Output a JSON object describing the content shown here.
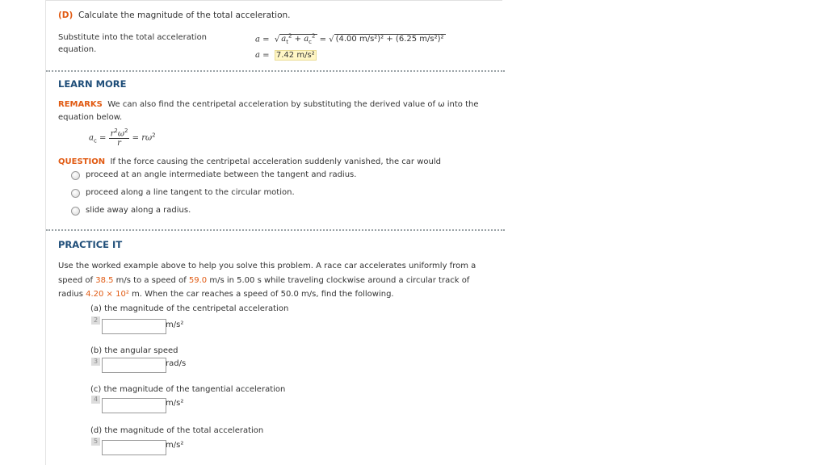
{
  "part_d": {
    "label": "(D)",
    "title": "Calculate the magnitude of the total acceleration.",
    "instruction_line1": "Substitute into the total acceleration",
    "instruction_line2": "equation.",
    "formula_rhs": "(4.00 m/s²)² + (6.25 m/s²)²",
    "result_value": "7.42 m/s²"
  },
  "learn_more": {
    "heading": "LEARN MORE",
    "remarks_label": "REMARKS",
    "remarks_text_1": "We can also find the centripetal acceleration by substituting the derived value of ω into the",
    "remarks_text_2": "equation below.",
    "question_label": "QUESTION",
    "question_text": "If the force causing the centripetal acceleration suddenly vanished, the car would",
    "options": [
      "proceed at an angle intermediate between the tangent and radius.",
      "proceed along a line tangent to the circular motion.",
      "slide away along a radius."
    ]
  },
  "practice": {
    "heading": "PRACTICE IT",
    "p1": "Use the worked example above to help you solve this problem. A race car accelerates uniformly from a",
    "p2a": "speed of ",
    "v1": "38.5",
    "p2b": " m/s to a speed of ",
    "v2": "59.0",
    "p2c": " m/s in 5.00 s while traveling clockwise around a circular track of",
    "p3a": "radius ",
    "v3": "4.20 × 10²",
    "p3b": " m. When the car reaches a speed of 50.0 m/s, find the following.",
    "parts": [
      {
        "label": "(a) the magnitude of the centripetal acceleration",
        "num": "2",
        "unit": "m/s²",
        "value": ""
      },
      {
        "label": "(b) the angular speed",
        "num": "3",
        "unit": "rad/s",
        "value": ""
      },
      {
        "label": "(c) the magnitude of the tangential acceleration",
        "num": "4",
        "unit": "m/s²",
        "value": ""
      },
      {
        "label": "(d) the magnitude of the total acceleration",
        "num": "5",
        "unit": "m/s²",
        "value": ""
      }
    ]
  }
}
